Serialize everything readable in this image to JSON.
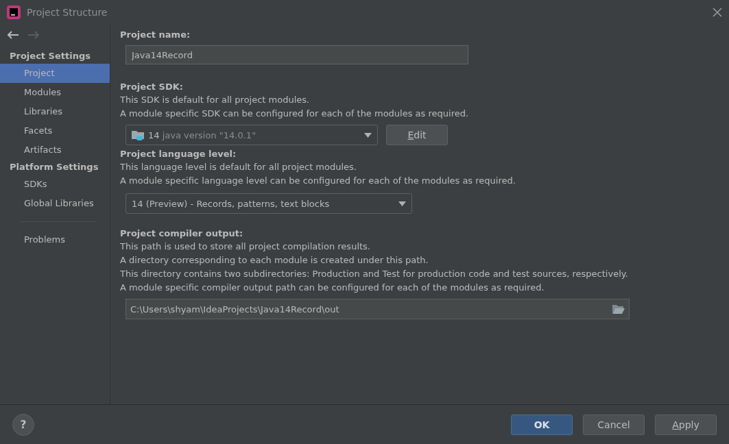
{
  "window": {
    "title": "Project Structure"
  },
  "nav": {
    "back_disabled": false,
    "forward_disabled": true
  },
  "sidebar": {
    "groups": [
      {
        "title": "Project Settings",
        "items": [
          {
            "label": "Project",
            "selected": true
          },
          {
            "label": "Modules",
            "selected": false
          },
          {
            "label": "Libraries",
            "selected": false
          },
          {
            "label": "Facets",
            "selected": false
          },
          {
            "label": "Artifacts",
            "selected": false
          }
        ]
      },
      {
        "title": "Platform Settings",
        "items": [
          {
            "label": "SDKs",
            "selected": false
          },
          {
            "label": "Global Libraries",
            "selected": false
          }
        ]
      }
    ],
    "bottom_items": [
      {
        "label": "Problems",
        "selected": false
      }
    ]
  },
  "project_name": {
    "label": "Project name:",
    "value": "Java14Record"
  },
  "project_sdk": {
    "label": "Project SDK:",
    "description": [
      "This SDK is default for all project modules.",
      "A module specific SDK can be configured for each of the modules as required."
    ],
    "sdk_version": "14",
    "sdk_detail": "java version \"14.0.1\"",
    "edit_button": {
      "label": "Edit",
      "mnemonic": true
    }
  },
  "language_level": {
    "label": "Project language level:",
    "description": [
      "This language level is default for all project modules.",
      "A module specific language level can be configured for each of the modules as required."
    ],
    "value": "14 (Preview) - Records, patterns, text blocks"
  },
  "compiler_output": {
    "label": "Project compiler output:",
    "description": [
      "This path is used to store all project compilation results.",
      "A directory corresponding to each module is created under this path.",
      "This directory contains two subdirectories: Production and Test for production code and test sources, respectively.",
      "A module specific compiler output path can be configured for each of the modules as required."
    ],
    "value": "C:\\Users\\shyam\\IdeaProjects\\Java14Record\\out"
  },
  "footer": {
    "help": "?",
    "buttons": [
      {
        "label": "OK",
        "kind": "primary",
        "mnemonic": false
      },
      {
        "label": "Cancel",
        "kind": "normal",
        "mnemonic": false
      },
      {
        "label": "Apply",
        "kind": "normal",
        "mnemonic": true
      }
    ]
  }
}
